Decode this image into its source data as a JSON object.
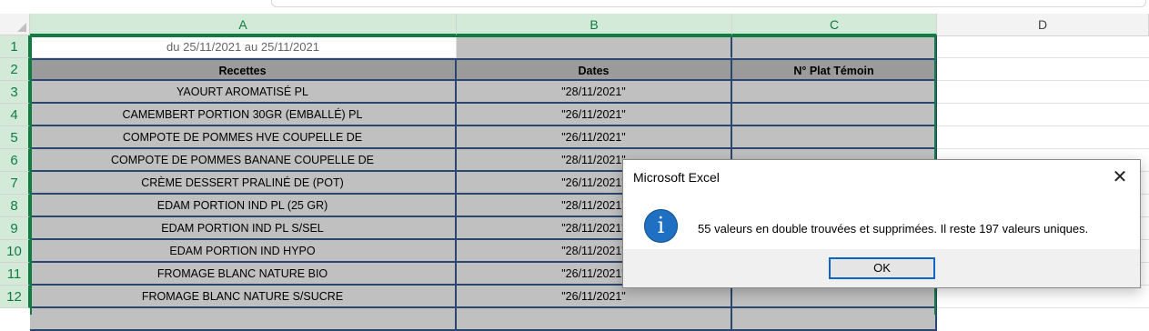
{
  "columns": [
    "A",
    "B",
    "C",
    "D"
  ],
  "rows": [
    "1",
    "2",
    "3",
    "4",
    "5",
    "6",
    "7",
    "8",
    "9",
    "10",
    "11",
    "12"
  ],
  "sheet": {
    "a1": "du 25/11/2021 au 25/11/2021",
    "headers": {
      "a": "Recettes",
      "b": "Dates",
      "c": "N° Plat Témoin"
    },
    "data": [
      {
        "recette": "YAOURT AROMATISÉ PL",
        "date": "\"28/11/2021\""
      },
      {
        "recette": "CAMEMBERT PORTION 30GR (EMBALLÉ)  PL",
        "date": "\"26/11/2021\""
      },
      {
        "recette": "COMPOTE DE POMMES HVE COUPELLE DE",
        "date": "\"26/11/2021\""
      },
      {
        "recette": "COMPOTE DE POMMES BANANE COUPELLE DE",
        "date": "\"28/11/2021\""
      },
      {
        "recette": "CRÈME DESSERT PRALINÉ DE (POT)",
        "date": "\"26/11/2021\""
      },
      {
        "recette": "EDAM PORTION IND PL (25 GR)",
        "date": "\"28/11/2021\""
      },
      {
        "recette": "EDAM PORTION IND PL S/SEL",
        "date": "\"28/11/2021\""
      },
      {
        "recette": "EDAM PORTION IND HYPO",
        "date": "\"28/11/2021\""
      },
      {
        "recette": "FROMAGE BLANC NATURE BIO",
        "date": "\"26/11/2021\""
      },
      {
        "recette": "FROMAGE BLANC NATURE S/SUCRE",
        "date": "\"26/11/2021\""
      }
    ]
  },
  "dialog": {
    "title": "Microsoft Excel",
    "close": "✕",
    "icon": "info-icon",
    "icon_glyph": "i",
    "message": "55 valeurs en double trouvées et supprimées. Il reste 197 valeurs uniques.",
    "ok_label": "OK"
  },
  "colors": {
    "selection_green": "#107c41",
    "table_gray": "#c0c0c0",
    "header_gray": "#9b9b9b",
    "border_navy": "#2b4670",
    "info_blue": "#1f6fc2"
  }
}
